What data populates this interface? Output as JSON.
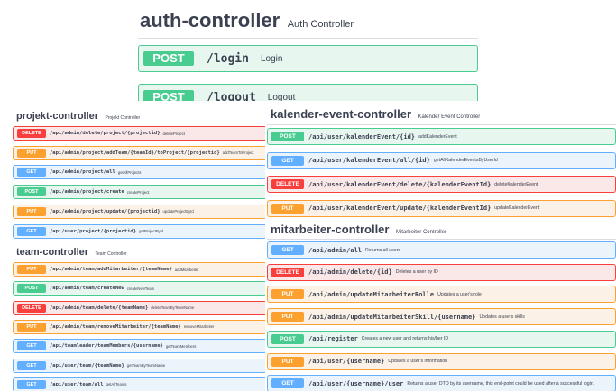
{
  "auth": {
    "title": "auth-controller",
    "desc": "Auth Controller",
    "ops": [
      {
        "method": "POST",
        "path": "/login",
        "summary": "Login"
      },
      {
        "method": "POST",
        "path": "/logout",
        "summary": "Logout"
      }
    ]
  },
  "projekt": {
    "title": "projekt-controller",
    "desc": "Projekt Controller",
    "ops": [
      {
        "method": "DELETE",
        "path": "/api/admin/delete/project/{projectid}",
        "summary": "deleteProject"
      },
      {
        "method": "PUT",
        "path": "/api/admin/project/addTeam/{teamId}/toProject/{projectid}",
        "summary": "addTeamToProject"
      },
      {
        "method": "GET",
        "path": "/api/admin/project/all",
        "summary": "getAllProjects"
      },
      {
        "method": "POST",
        "path": "/api/admin/project/create",
        "summary": "createProject"
      },
      {
        "method": "PUT",
        "path": "/api/admin/project/update/{projectid}",
        "summary": "updateProjectById"
      },
      {
        "method": "GET",
        "path": "/api/user/project/{projectid}",
        "summary": "getProjectById"
      }
    ]
  },
  "team": {
    "title": "team-controller",
    "desc": "Team Controller",
    "ops": [
      {
        "method": "PUT",
        "path": "/api/admin/team/addMitarbeiter/{teamName}",
        "summary": "addMitarbeiter"
      },
      {
        "method": "POST",
        "path": "/api/admin/team/createNew",
        "summary": "createNewTeam"
      },
      {
        "method": "DELETE",
        "path": "/api/admin/team/delete/{teamName}",
        "summary": "deleteTeamByTeamName"
      },
      {
        "method": "PUT",
        "path": "/api/admin/team/removeMitarbeiter/{teamName}",
        "summary": "removeMitarbeiter"
      },
      {
        "method": "GET",
        "path": "/api/teamleader/teamMembers/{username}",
        "summary": "getTeamMembers"
      },
      {
        "method": "GET",
        "path": "/api/user/team/{teamName}",
        "summary": "getTeamByTeamName"
      },
      {
        "method": "GET",
        "path": "/api/user/team/all",
        "summary": "getAllTeams"
      }
    ]
  },
  "kalender": {
    "title": "kalender-event-controller",
    "desc": "Kalender Event Controller",
    "ops": [
      {
        "method": "POST",
        "path": "/api/user/kalenderEvent/{id}",
        "summary": "addKalenderEvent"
      },
      {
        "method": "GET",
        "path": "/api/user/kalenderEvent/all/{id}",
        "summary": "getAllKalenderEventsByUserId"
      },
      {
        "method": "DELETE",
        "path": "/api/user/kalenderEvent/delete/{kalenderEventId}",
        "summary": "deleteKalenderEvent"
      },
      {
        "method": "PUT",
        "path": "/api/user/kalenderEvent/update/{kalenderEventId}",
        "summary": "updateKalenderEvent"
      }
    ]
  },
  "mitarbeiter": {
    "title": "mitarbeiter-controller",
    "desc": "Mitarbeiter Controller",
    "ops": [
      {
        "method": "GET",
        "path": "/api/admin/all",
        "summary": "Returns all users"
      },
      {
        "method": "DELETE",
        "path": "/api/admin/delete/{id}",
        "summary": "Deletes a user by ID"
      },
      {
        "method": "PUT",
        "path": "/api/admin/updateMitarbeiterRolle",
        "summary": "Updates a user's role"
      },
      {
        "method": "PUT",
        "path": "/api/admin/updateMitarbeiterSkill/{username}",
        "summary": "Updates a users skills"
      },
      {
        "method": "POST",
        "path": "/api/register",
        "summary": "Creates a new user and returns his/her ID"
      },
      {
        "method": "PUT",
        "path": "/api/user/{username}",
        "summary": "Updates a user's information"
      },
      {
        "method": "GET",
        "path": "/api/user/{username}/user",
        "summary": "Returns a user DTO by its username, this end-point could be used after a successful login."
      }
    ]
  }
}
